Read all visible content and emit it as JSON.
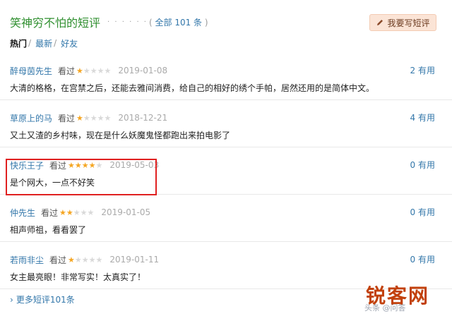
{
  "header": {
    "title": "笑神穷不怕的短评",
    "dots": "· · · · · ·",
    "total_label": "全部 101 条",
    "paren_open": "(",
    "paren_close": ")"
  },
  "write_button": {
    "label": "我要写短评",
    "icon": "pencil-icon"
  },
  "filters": {
    "hot": "热门",
    "sep1": "/",
    "latest": "最新",
    "sep2": "/",
    "friends": "好友"
  },
  "comments": [
    {
      "author": "醉母茵先生",
      "status": "看过",
      "rating": 1,
      "date": "2019-01-08",
      "votes": "2 有用",
      "text": "大清的格格，在宫禁之后，还能去雅间消费，给自己的相好的绣个手帕，居然还用的是简体中文。"
    },
    {
      "author": "草原上的马",
      "status": "看过",
      "rating": 1,
      "date": "2018-12-21",
      "votes": "4 有用",
      "text": "又土又渣的乡村味，现在是什么妖魔鬼怪都跑出来拍电影了"
    },
    {
      "author": "快乐王子",
      "status": "看过",
      "rating": 4,
      "date": "2019-05-03",
      "votes": "0 有用",
      "text": "是个网大，一点不好笑"
    },
    {
      "author": "仲先生",
      "status": "看过",
      "rating": 2,
      "date": "2019-01-05",
      "votes": "0 有用",
      "text": "相声师祖，看看罢了"
    },
    {
      "author": "若雨非尘",
      "status": "看过",
      "rating": 1,
      "date": "2019-01-11",
      "votes": "0 有用",
      "text": "女主最亮眼！非常写实！太真实了！"
    }
  ],
  "star_max": 5,
  "star_colors": {
    "on": "#f5a623",
    "off": "#d9d9d9"
  },
  "more_link": {
    "arrow": "›",
    "label": "更多短评101条"
  },
  "highlight_color": "#e02020",
  "watermark": {
    "logo": "锐客网",
    "faint": "头条 @问答"
  }
}
